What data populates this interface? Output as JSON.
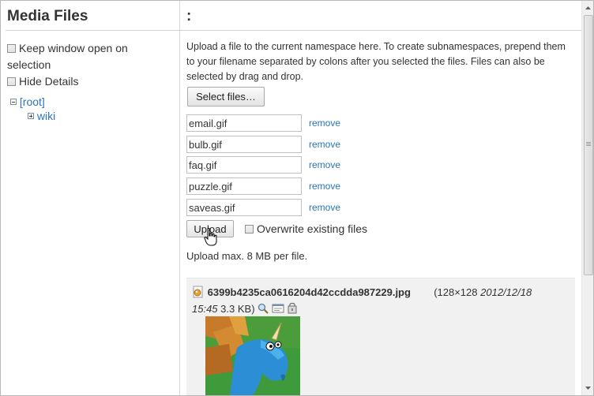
{
  "left_panel": {
    "title": "Media Files",
    "options": [
      {
        "label_line1": "Keep window open on",
        "label_line2": "selection",
        "checked": false
      },
      {
        "label_line1": "Hide Details",
        "checked": false
      }
    ],
    "tree": {
      "root": "[root]",
      "children": [
        "wiki"
      ]
    }
  },
  "right_panel": {
    "namespace_title": ":",
    "intro_text": "Upload a file to the current namespace here. To create subnamespaces, prepend them to your filename separated by colons after you selected the files. Files can also be selected by drag and drop.",
    "select_files_label": "Select files…",
    "files": [
      {
        "name": "email.gif",
        "remove_label": "remove"
      },
      {
        "name": "bulb.gif",
        "remove_label": "remove"
      },
      {
        "name": "faq.gif",
        "remove_label": "remove"
      },
      {
        "name": "puzzle.gif",
        "remove_label": "remove"
      },
      {
        "name": "saveas.gif",
        "remove_label": "remove"
      }
    ],
    "upload_label": "Upload",
    "overwrite_label": "Overwrite existing files",
    "max_size_text": "Upload max. 8 MB per file.",
    "media_item": {
      "filename": "6399b4235ca0616204d42ccdda987229.jpg",
      "dimensions": "(128×128",
      "date_part1": "2012/12/18",
      "date_part2": "15:45",
      "size": "3.3 KB)"
    }
  },
  "colors": {
    "link": "#2b73b7",
    "media_background": "#f1f1f1"
  }
}
